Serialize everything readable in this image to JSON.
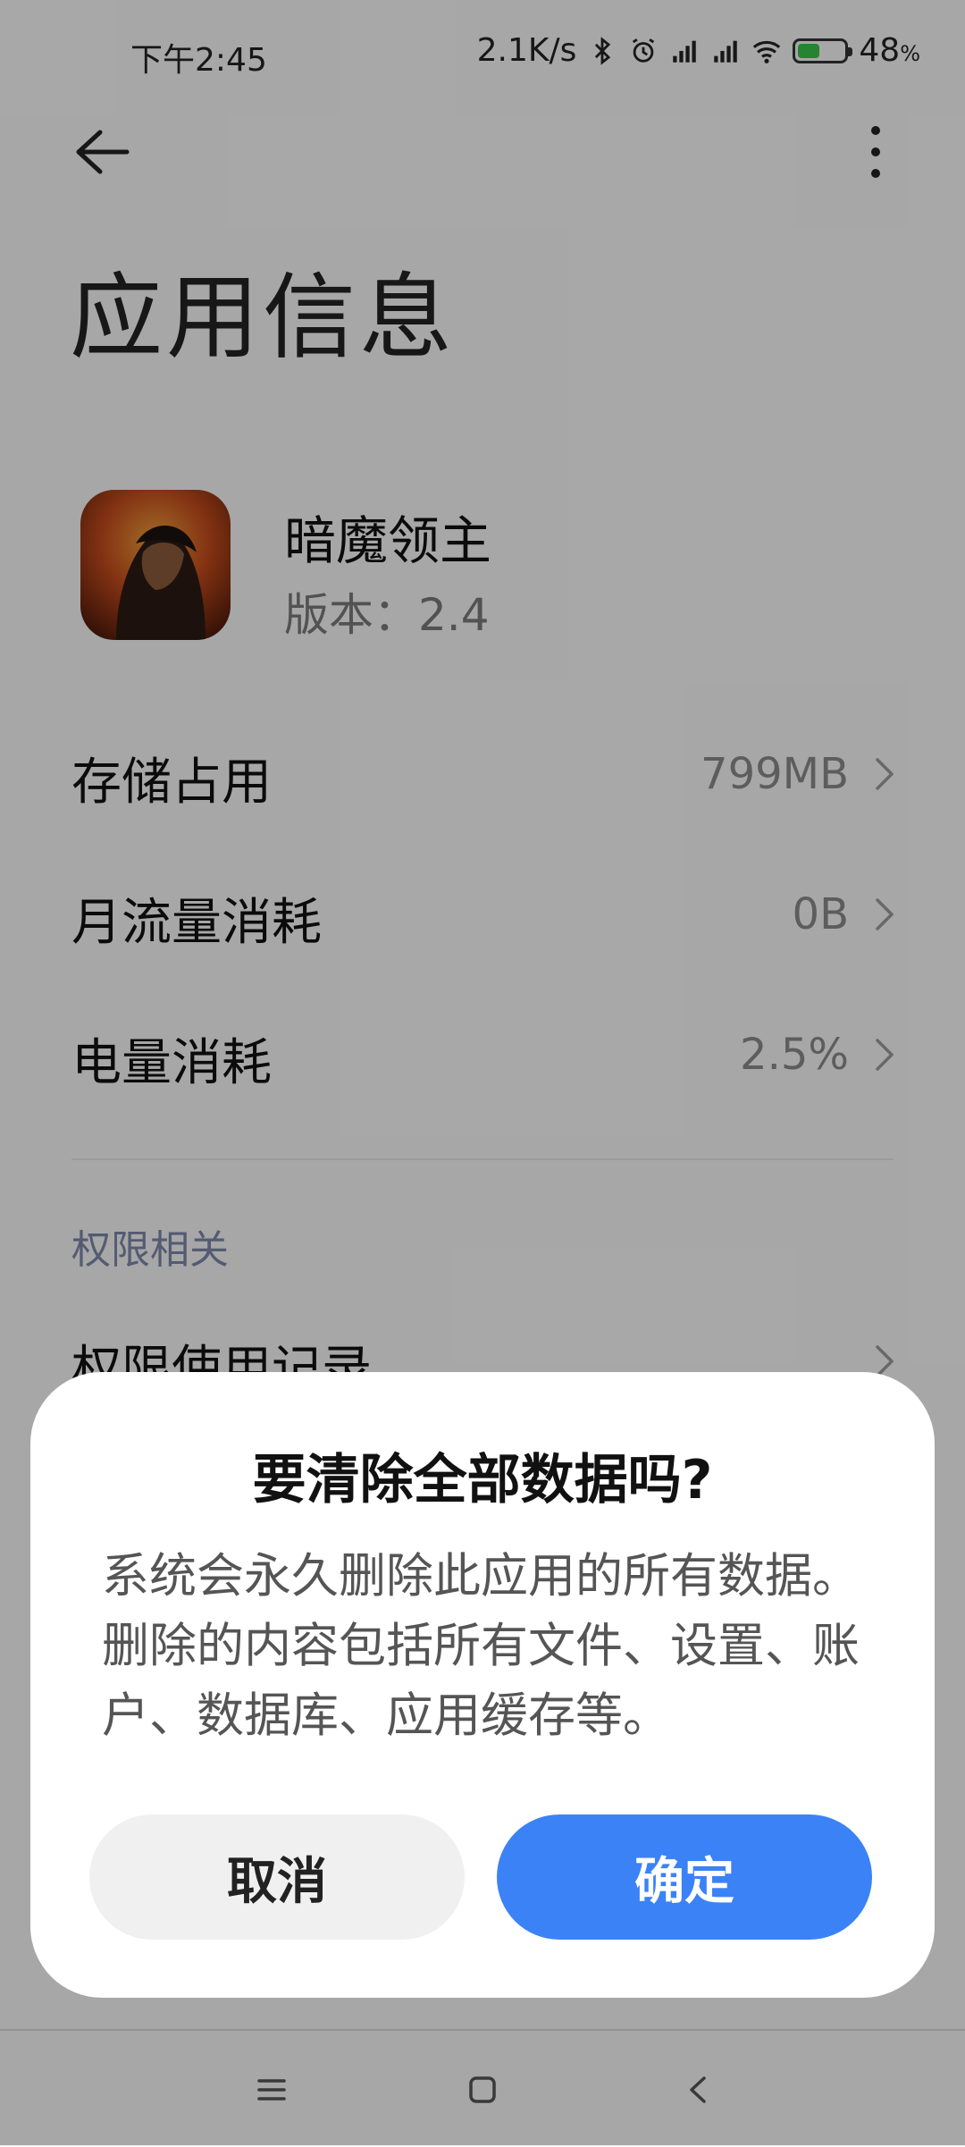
{
  "status": {
    "time": "下午2:45",
    "speed": "2.1K/s",
    "battery_pct": "48",
    "battery_unit": "%",
    "battery_level": 0.48
  },
  "header": {
    "title": "应用信息"
  },
  "app": {
    "name": "暗魔领主",
    "version": "版本：2.4"
  },
  "rows": [
    {
      "label": "存储占用",
      "value": "799MB"
    },
    {
      "label": "月流量消耗",
      "value": "0B"
    },
    {
      "label": "电量消耗",
      "value": "2.5%"
    }
  ],
  "section": {
    "title": "权限相关"
  },
  "permission_row": {
    "label": "权限使用记录"
  },
  "dialog": {
    "title": "要清除全部数据吗?",
    "body": "系统会永久删除此应用的所有数据。删除的内容包括所有文件、设置、账户、数据库、应用缓存等。",
    "cancel_label": "取消",
    "confirm_label": "确定"
  },
  "colors": {
    "accent": "#3b82f6",
    "battery": "#39c24a",
    "section_title": "#7d86a8"
  }
}
